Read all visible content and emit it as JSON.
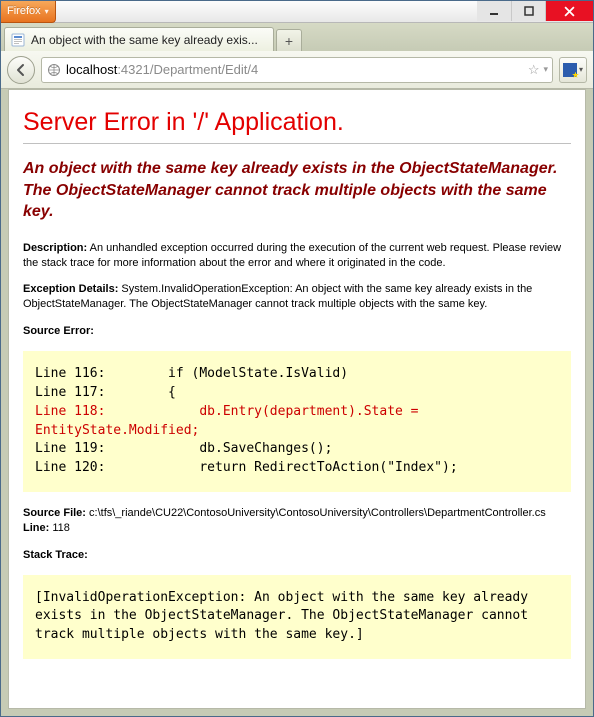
{
  "browser": {
    "app_label": "Firefox",
    "tab_title": "An object with the same key already exis...",
    "url_host": "localhost",
    "url_path": ":4321/Department/Edit/4"
  },
  "error": {
    "h1": "Server Error in '/' Application.",
    "h2": "An object with the same key already exists in the ObjectStateManager. The ObjectStateManager cannot track multiple objects with the same key.",
    "description_label": "Description:",
    "description_text": "An unhandled exception occurred during the execution of the current web request. Please review the stack trace for more information about the error and where it originated in the code.",
    "exception_label": "Exception Details:",
    "exception_text": "System.InvalidOperationException: An object with the same key already exists in the ObjectStateManager. The ObjectStateManager cannot track multiple objects with the same key.",
    "source_error_label": "Source Error:",
    "code_line_116": "Line 116:        if (ModelState.IsValid)",
    "code_line_117": "Line 117:        {",
    "code_line_118": "Line 118:            db.Entry(department).State = EntityState.Modified;",
    "code_line_119": "Line 119:            db.SaveChanges();",
    "code_line_120": "Line 120:            return RedirectToAction(\"Index\");",
    "source_file_label": "Source File:",
    "source_file_text": "c:\\tfs\\_riande\\CU22\\ContosoUniversity\\ContosoUniversity\\Controllers\\DepartmentController.cs",
    "line_label": "Line:",
    "line_text": "118",
    "stack_trace_label": "Stack Trace:",
    "stack_trace_text": "[InvalidOperationException: An object with the same key already exists in the ObjectStateManager. The ObjectStateManager cannot track multiple objects with the same key.]"
  }
}
